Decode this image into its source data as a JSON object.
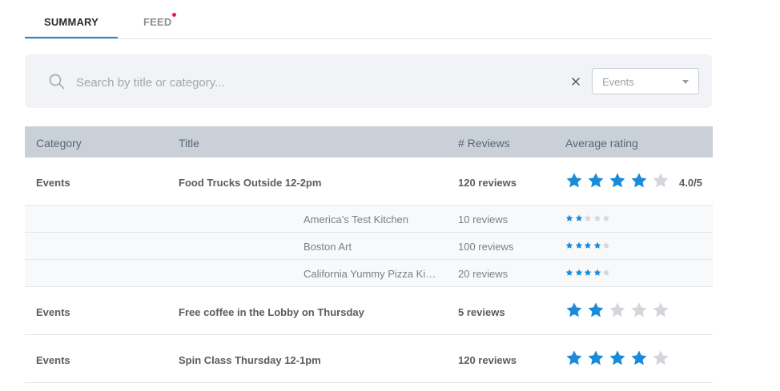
{
  "tabs": [
    {
      "label": "SUMMARY",
      "active": true
    },
    {
      "label": "FEED",
      "active": false,
      "has_notification": true
    }
  ],
  "search": {
    "placeholder": "Search by title or category...",
    "value": ""
  },
  "filter": {
    "selected": "Events"
  },
  "table": {
    "headers": {
      "category": "Category",
      "title": "Title",
      "reviews": "# Reviews",
      "rating": "Average rating"
    },
    "rows": [
      {
        "category": "Events",
        "title": "Food Trucks Outside 12-2pm",
        "reviews": "120 reviews",
        "stars": 4,
        "rating_text": "4.0/5"
      },
      {
        "title": "America’s Test Kitchen",
        "reviews": "10 reviews",
        "stars": 2
      },
      {
        "title": "Boston Art",
        "reviews": "100 reviews",
        "stars": 4
      },
      {
        "title": "California Yummy Pizza Ki…",
        "reviews": "20 reviews",
        "stars": 4
      },
      {
        "category": "Events",
        "title": "Free coffee in the Lobby on Thursday",
        "reviews": "5 reviews",
        "stars": 2
      },
      {
        "category": "Events",
        "title": "Spin Class Thursday 12-1pm",
        "reviews": "120 reviews",
        "stars": 4
      }
    ]
  },
  "colors": {
    "accent": "#1a8bd8",
    "star_filled": "#1a8bd8",
    "star_empty": "#d3d7dc",
    "notification_dot": "#e2195d",
    "header_bg": "#c9d0d8"
  }
}
